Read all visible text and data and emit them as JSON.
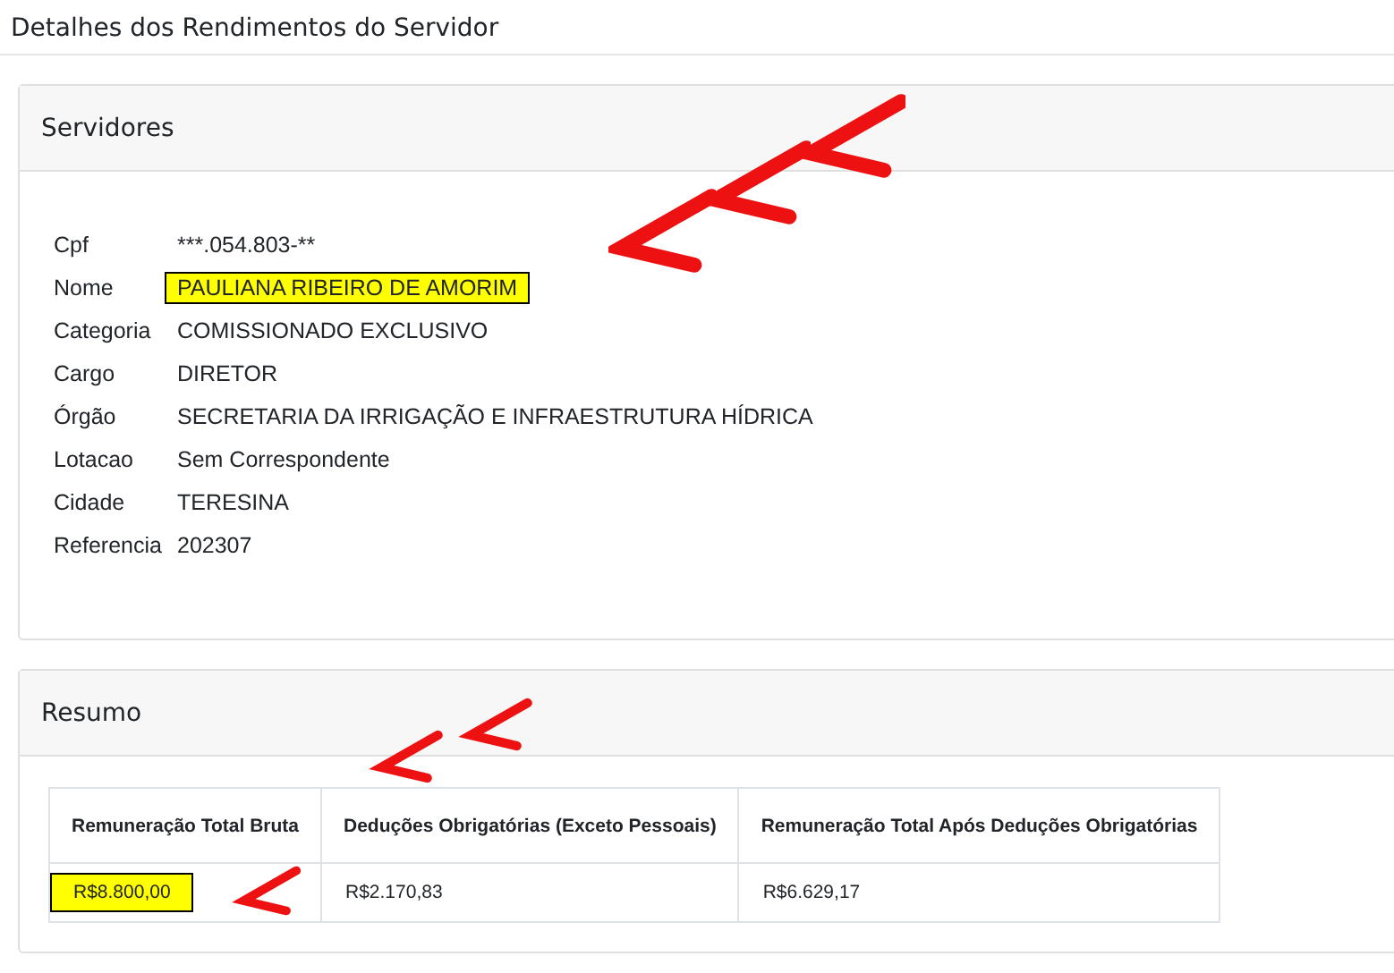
{
  "page": {
    "title": "Detalhes dos Rendimentos do Servidor"
  },
  "servidores": {
    "title": "Servidores",
    "fields": [
      {
        "label": "Cpf",
        "value": "***.054.803-**",
        "highlighted": false
      },
      {
        "label": "Nome",
        "value": "PAULIANA RIBEIRO DE AMORIM",
        "highlighted": true
      },
      {
        "label": "Categoria",
        "value": "COMISSIONADO EXCLUSIVO",
        "highlighted": false
      },
      {
        "label": "Cargo",
        "value": "DIRETOR",
        "highlighted": false
      },
      {
        "label": "Órgão",
        "value": "SECRETARIA DA IRRIGAÇÃO E INFRAESTRUTURA HÍDRICA",
        "highlighted": false
      },
      {
        "label": "Lotacao",
        "value": "Sem Correspondente",
        "highlighted": false
      },
      {
        "label": "Cidade",
        "value": "TERESINA",
        "highlighted": false
      },
      {
        "label": "Referencia",
        "value": "202307",
        "highlighted": false
      }
    ]
  },
  "resumo": {
    "title": "Resumo",
    "table": {
      "columns": [
        "Remuneração Total Bruta",
        "Deduções Obrigatórias (Exceto Pessoais)",
        "Remuneração Total Após Deduções Obrigatórias"
      ],
      "rows": [
        [
          {
            "text": "R$8.800,00",
            "highlighted": true
          },
          {
            "text": "R$2.170,83",
            "highlighted": false
          },
          {
            "text": "R$6.629,17",
            "highlighted": false
          }
        ]
      ]
    }
  }
}
